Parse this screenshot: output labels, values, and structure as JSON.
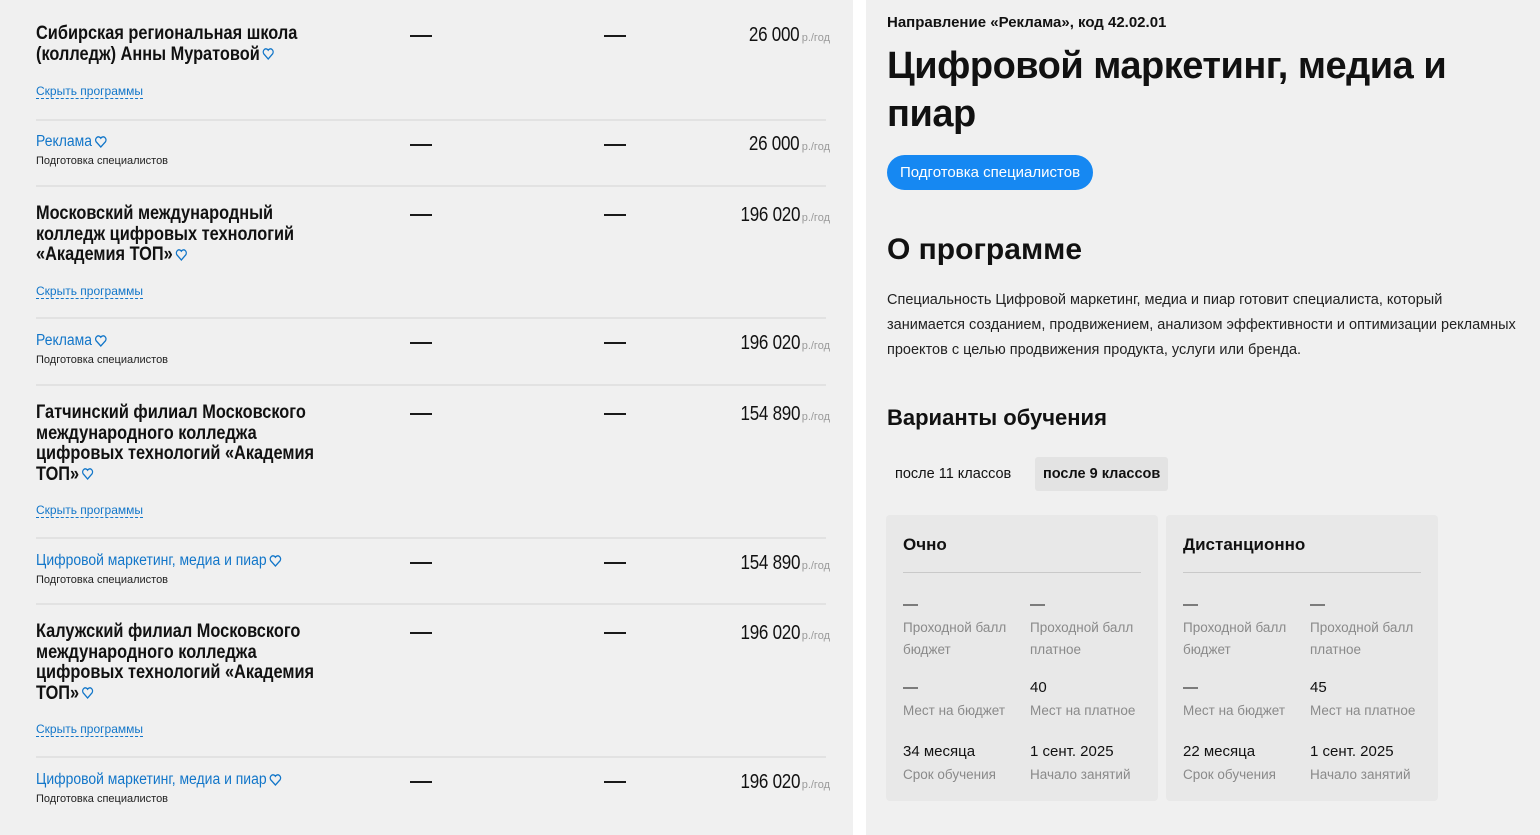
{
  "left": {
    "blocks": [
      {
        "type": "college",
        "name": "Сибирская региональная школа (колледж) Анны Муратовой",
        "toggle": "Скрыть программы",
        "col1": "—",
        "col2": "—",
        "price": "26 000",
        "unit": "р./год"
      },
      {
        "type": "program",
        "name": "Реклама",
        "sub": "Подготовка специалистов",
        "col1": "—",
        "col2": "—",
        "price": "26 000",
        "unit": "р./год"
      },
      {
        "type": "college",
        "name": "Московский международный колледж цифровых технологий «Академия ТОП»",
        "toggle": "Скрыть программы",
        "col1": "—",
        "col2": "—",
        "price": "196 020",
        "unit": "р./год"
      },
      {
        "type": "program",
        "name": "Реклама",
        "sub": "Подготовка специалистов",
        "col1": "—",
        "col2": "—",
        "price": "196 020",
        "unit": "р./год"
      },
      {
        "type": "college",
        "name": "Гатчинский филиал Московского международного колледжа цифровых технологий «Академия ТОП»",
        "toggle": "Скрыть программы",
        "col1": "—",
        "col2": "—",
        "price": "154 890",
        "unit": "р./год"
      },
      {
        "type": "program",
        "name": "Цифровой маркетинг, медиа и пиар",
        "sub": "Подготовка специалистов",
        "col1": "—",
        "col2": "—",
        "price": "154 890",
        "unit": "р./год"
      },
      {
        "type": "college",
        "name": "Калужский филиал Московского международного колледжа цифровых технологий «Академия ТОП»",
        "toggle": "Скрыть программы",
        "col1": "—",
        "col2": "—",
        "price": "196 020",
        "unit": "р./год"
      },
      {
        "type": "program",
        "name": "Цифровой маркетинг, медиа и пиар",
        "sub": "Подготовка специалистов",
        "col1": "—",
        "col2": "—",
        "price": "196 020",
        "unit": "р./год"
      }
    ]
  },
  "right": {
    "direction": "Направление «Реклама», код 42.02.01",
    "title": "Цифровой маркетинг, медиа и пиар",
    "badge": "Подготовка специалистов",
    "about_heading": "О программе",
    "about_text": "Специальность Цифровой маркетинг, медиа и пиар готовит специалиста, который занимается созданием, продвижением, анализом эффективности и оптимизации рекламных проектов с целью продвижения продукта, услуги или бренда.",
    "variants_heading": "Варианты обучения",
    "tabs": [
      "после 11 классов",
      "после 9 классов"
    ],
    "active_tab": "после 9 классов",
    "cards": [
      {
        "title": "Очно",
        "stats": [
          {
            "value": "—",
            "label": "Проходной балл бюджет"
          },
          {
            "value": "—",
            "label": "Проходной балл платное"
          },
          {
            "value": "—",
            "label": "Мест на бюджет"
          },
          {
            "value": "40",
            "label": "Мест на платное"
          },
          {
            "value": "34 месяца",
            "label": "Срок обучения"
          },
          {
            "value": "1 сент. 2025",
            "label": "Начало занятий"
          }
        ]
      },
      {
        "title": "Дистанционно",
        "stats": [
          {
            "value": "—",
            "label": "Проходной балл бюджет"
          },
          {
            "value": "—",
            "label": "Проходной балл платное"
          },
          {
            "value": "—",
            "label": "Мест на бюджет"
          },
          {
            "value": "45",
            "label": "Мест на платное"
          },
          {
            "value": "22 месяца",
            "label": "Срок обучения"
          },
          {
            "value": "1 сент. 2025",
            "label": "Начало занятий"
          }
        ]
      }
    ]
  },
  "colors": {
    "accent": "#1688f2",
    "link": "#1276c9",
    "panel_bg": "#f0f0f0",
    "card_bg": "#e8e8e8"
  },
  "icons": {
    "favorite": "heart-outline-icon"
  }
}
